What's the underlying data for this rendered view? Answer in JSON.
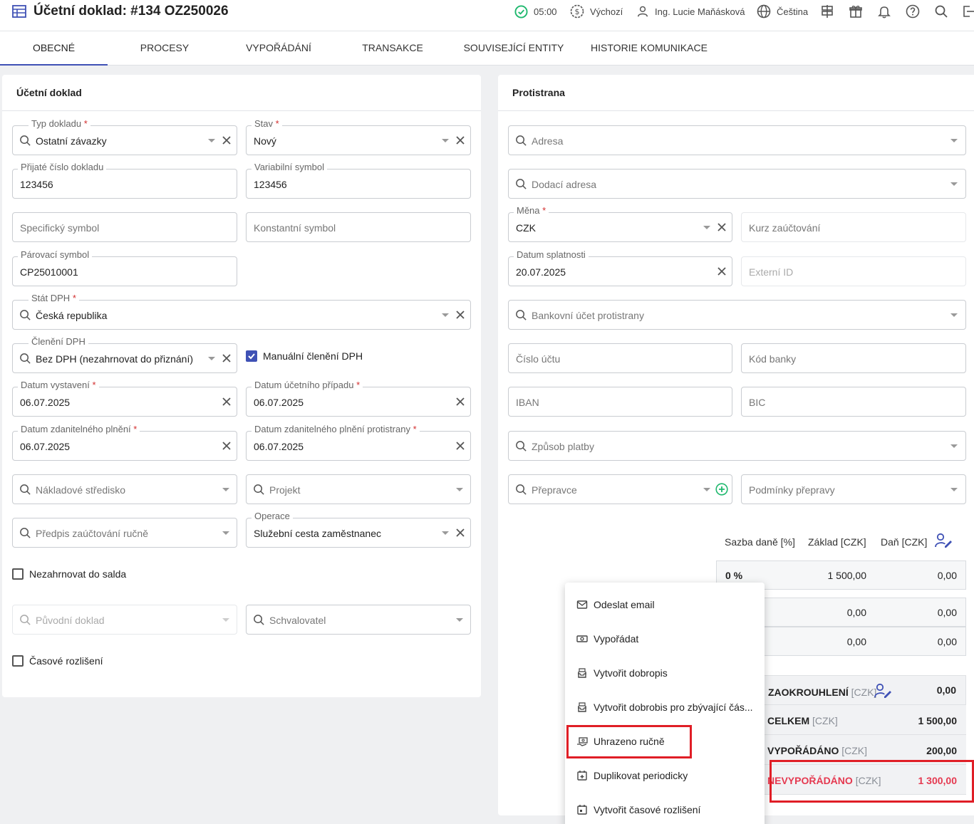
{
  "header": {
    "title": "Účetní doklad: #134 OZ250026",
    "time": "05:00",
    "profile": "Výchozí",
    "user": "Ing. Lucie Maňásková",
    "language": "Čeština"
  },
  "tabs": [
    "OBECNÉ",
    "PROCESY",
    "VYPOŘÁDÁNÍ",
    "TRANSAKCE",
    "SOUVISEJÍCÍ ENTITY",
    "HISTORIE KOMUNIKACE"
  ],
  "left_card": {
    "title": "Účetní doklad",
    "typ_dokladu": {
      "label": "Typ dokladu",
      "value": "Ostatní závazky"
    },
    "stav": {
      "label": "Stav",
      "value": "Nový"
    },
    "prijate_cislo": {
      "label": "Přijaté číslo dokladu",
      "value": "123456"
    },
    "variabilni_symbol": {
      "label": "Variabilní symbol",
      "value": "123456"
    },
    "specificky_symbol": {
      "placeholder": "Specifický symbol"
    },
    "konstantni_symbol": {
      "placeholder": "Konstantní symbol"
    },
    "parovaci_symbol": {
      "label": "Párovací symbol",
      "value": "CP25010001"
    },
    "stat_dph": {
      "label": "Stát DPH",
      "value": "Česká republika"
    },
    "cleneni_dph": {
      "label": "Členění DPH",
      "value": "Bez DPH (nezahrnovat do přiznání)"
    },
    "manualni_cleneni": {
      "label": "Manuální členění DPH",
      "checked": true
    },
    "datum_vystaveni": {
      "label": "Datum vystavení",
      "value": "06.07.2025"
    },
    "datum_ucetniho_pripadu": {
      "label": "Datum účetního případu",
      "value": "06.07.2025"
    },
    "datum_zdanitelneho": {
      "label": "Datum zdanitelného plnění",
      "value": "06.07.2025"
    },
    "datum_zdanitelneho_protistrany": {
      "label": "Datum zdanitelného plnění protistrany",
      "value": "06.07.2025"
    },
    "nakladove_stredisko": {
      "placeholder": "Nákladové středisko"
    },
    "projekt": {
      "placeholder": "Projekt"
    },
    "predpis": {
      "placeholder": "Předpis zaúčtování ručně"
    },
    "operace": {
      "label": "Operace",
      "value": "Služební cesta zaměstnanec"
    },
    "nezahrnovat": {
      "label": "Nezahrnovat do salda",
      "checked": false
    },
    "puvodni_doklad": {
      "placeholder": "Původní doklad"
    },
    "schvalovatel": {
      "placeholder": "Schvalovatel"
    },
    "casove_rozliseni": {
      "label": "Časové rozlišení",
      "checked": false
    }
  },
  "right_card": {
    "title": "Protistrana",
    "adresa": {
      "placeholder": "Adresa"
    },
    "dodaci_adresa": {
      "placeholder": "Dodací adresa"
    },
    "mena": {
      "label": "Měna",
      "value": "CZK"
    },
    "kurz": {
      "placeholder": "Kurz zaúčtování"
    },
    "datum_splatnosti": {
      "label": "Datum splatnosti",
      "value": "20.07.2025"
    },
    "externi_id": {
      "placeholder": "Externí ID"
    },
    "bankovni_ucet": {
      "placeholder": "Bankovní účet protistrany"
    },
    "cislo_uctu": {
      "placeholder": "Číslo účtu"
    },
    "kod_banky": {
      "placeholder": "Kód banky"
    },
    "iban": {
      "placeholder": "IBAN"
    },
    "bic": {
      "placeholder": "BIC"
    },
    "zpusob_platby": {
      "placeholder": "Způsob platby"
    },
    "prepravce": {
      "placeholder": "Přepravce"
    },
    "podminky_prepravy": {
      "placeholder": "Podmínky přepravy"
    }
  },
  "vat_table": {
    "headers": [
      "Sazba daně [%]",
      "Základ [CZK]",
      "Daň [CZK]"
    ],
    "rows": [
      {
        "rate": "0 %",
        "base": "1 500,00",
        "tax": "0,00"
      },
      {
        "rate": "",
        "base": "0,00",
        "tax": "0,00"
      },
      {
        "rate": "",
        "base": "0,00",
        "tax": "0,00"
      }
    ]
  },
  "summary": {
    "zaokrouhleni": {
      "label": "ZAOKROUHLENÍ",
      "unit": "[CZK]",
      "value": "0,00"
    },
    "celkem": {
      "label": "CELKEM",
      "unit": "[CZK]",
      "value": "1 500,00"
    },
    "vyporadano": {
      "label": "VYPOŘÁDÁNO",
      "unit": "[CZK]",
      "value": "200,00"
    },
    "nevyporadano": {
      "label": "NEVYPOŘÁDÁNO",
      "unit": "[CZK]",
      "value": "1 300,00",
      "color": "#e53950"
    }
  },
  "context_menu": {
    "items": [
      {
        "label": "Odeslat email",
        "icon": "email-icon"
      },
      {
        "label": "Vypořádat",
        "icon": "money-icon"
      },
      {
        "label": "Vytvořit dobropis",
        "icon": "receipt-icon"
      },
      {
        "label": "Vytvořit dobrobis pro zbývající čás...",
        "icon": "receipt-icon"
      },
      {
        "label": "Uhrazeno ručně",
        "icon": "cash-hand-icon"
      },
      {
        "label": "Duplikovat periodicky",
        "icon": "calendar-plus-icon"
      },
      {
        "label": "Vytvořit časové rozlišení",
        "icon": "calendar-icon"
      }
    ]
  },
  "colors": {
    "accent": "#3f51b5",
    "required": "#d32f2f",
    "highlight": "#e01e26",
    "success": "#1fb86e"
  }
}
